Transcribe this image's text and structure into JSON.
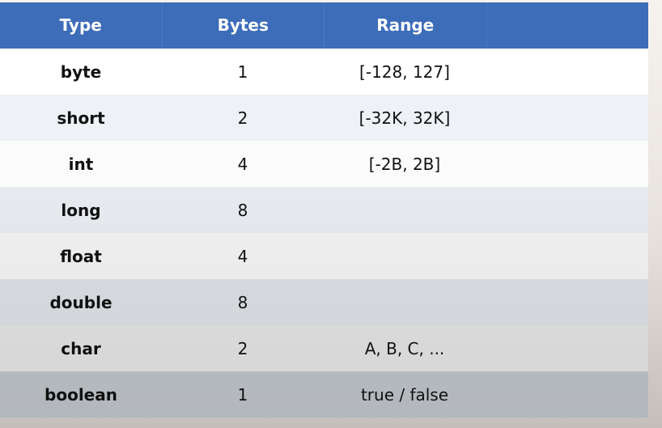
{
  "table": {
    "headers": [
      "Type",
      "Bytes",
      "Range",
      ""
    ],
    "rows": [
      {
        "type": "byte",
        "bytes": "1",
        "range": "[-128, 127]"
      },
      {
        "type": "short",
        "bytes": "2",
        "range": "[-32K, 32K]"
      },
      {
        "type": "int",
        "bytes": "4",
        "range": "[-2B, 2B]"
      },
      {
        "type": "long",
        "bytes": "8",
        "range": ""
      },
      {
        "type": "float",
        "bytes": "4",
        "range": ""
      },
      {
        "type": "double",
        "bytes": "8",
        "range": ""
      },
      {
        "type": "char",
        "bytes": "2",
        "range": "A, B, C, ..."
      },
      {
        "type": "boolean",
        "bytes": "1",
        "range": "true / false"
      }
    ]
  },
  "colors": {
    "header": "#3d6cb9",
    "header_text": "#ffffff"
  }
}
